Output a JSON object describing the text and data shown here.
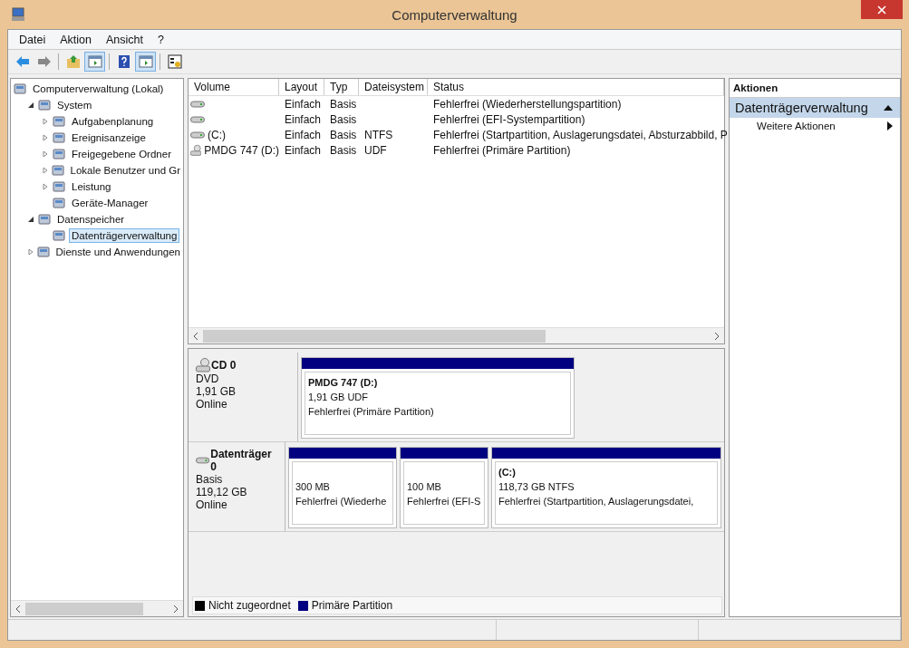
{
  "window": {
    "title": "Computerverwaltung"
  },
  "menu": [
    "Datei",
    "Aktion",
    "Ansicht",
    "?"
  ],
  "toolbar": [
    {
      "kind": "back",
      "selected": false
    },
    {
      "kind": "forward",
      "selected": false
    },
    {
      "kind": "sep"
    },
    {
      "kind": "up",
      "selected": false
    },
    {
      "kind": "tree",
      "selected": true
    },
    {
      "kind": "sep"
    },
    {
      "kind": "help",
      "selected": false
    },
    {
      "kind": "pane",
      "selected": true
    },
    {
      "kind": "sep"
    },
    {
      "kind": "props",
      "selected": false
    }
  ],
  "tree": {
    "label": "Computerverwaltung (Lokal)",
    "selected": false,
    "children": [
      {
        "label": "System",
        "expanded": true,
        "selected": false,
        "children": [
          {
            "label": "Aufgabenplanung",
            "expanded": false,
            "selected": false
          },
          {
            "label": "Ereignisanzeige",
            "expanded": false,
            "selected": false
          },
          {
            "label": "Freigegebene Ordner",
            "expanded": false,
            "selected": false
          },
          {
            "label": "Lokale Benutzer und Gr",
            "expanded": false,
            "selected": false
          },
          {
            "label": "Leistung",
            "expanded": false,
            "selected": false
          },
          {
            "label": "Geräte-Manager",
            "selected": false
          }
        ]
      },
      {
        "label": "Datenspeicher",
        "expanded": true,
        "selected": false,
        "children": [
          {
            "label": "Datenträgerverwaltung",
            "selected": true
          }
        ]
      },
      {
        "label": "Dienste und Anwendungen",
        "expanded": false,
        "selected": false
      }
    ]
  },
  "volumes": {
    "columns": [
      "Volume",
      "Layout",
      "Typ",
      "Dateisystem",
      "Status"
    ],
    "rows": [
      {
        "kind": "disk",
        "cells": [
          "",
          "Einfach",
          "Basis",
          "",
          "Fehlerfrei (Wiederherstellungspartition)"
        ]
      },
      {
        "kind": "disk",
        "cells": [
          "",
          "Einfach",
          "Basis",
          "",
          "Fehlerfrei (EFI-Systempartition)"
        ]
      },
      {
        "kind": "disk",
        "cells": [
          "(C:)",
          "Einfach",
          "Basis",
          "NTFS",
          "Fehlerfrei (Startpartition, Auslagerungsdatei, Absturzabbild, P"
        ]
      },
      {
        "kind": "cd",
        "cells": [
          "PMDG 747 (D:)",
          "Einfach",
          "Basis",
          "UDF",
          "Fehlerfrei (Primäre Partition)"
        ]
      }
    ]
  },
  "disks": [
    {
      "kind": "cd",
      "name": "CD 0",
      "type": "DVD",
      "size": "1,91 GB",
      "state": "Online",
      "partitions": [
        {
          "label": "PMDG 747  (D:)",
          "size": "1,91 GB UDF",
          "status": "Fehlerfrei (Primäre Partition)"
        }
      ]
    },
    {
      "kind": "disk",
      "name": "Datenträger 0",
      "type": "Basis",
      "size": "119,12 GB",
      "state": "Online",
      "partitions": [
        {
          "size": "300 MB",
          "status": "Fehlerfrei (Wiederhe"
        },
        {
          "size": "100 MB",
          "status": "Fehlerfrei (EFI-S"
        },
        {
          "label": "(C:)",
          "size": "118,73 GB NTFS",
          "status": "Fehlerfrei (Startpartition, Auslagerungsdatei,"
        }
      ]
    }
  ],
  "legend": [
    {
      "label": "Nicht zugeordnet",
      "color": "#000000"
    },
    {
      "label": "Primäre Partition",
      "color": "#000080"
    }
  ],
  "actions": {
    "title": "Aktionen",
    "section": "Datenträgerverwaltung",
    "items": [
      "Weitere Aktionen"
    ]
  }
}
